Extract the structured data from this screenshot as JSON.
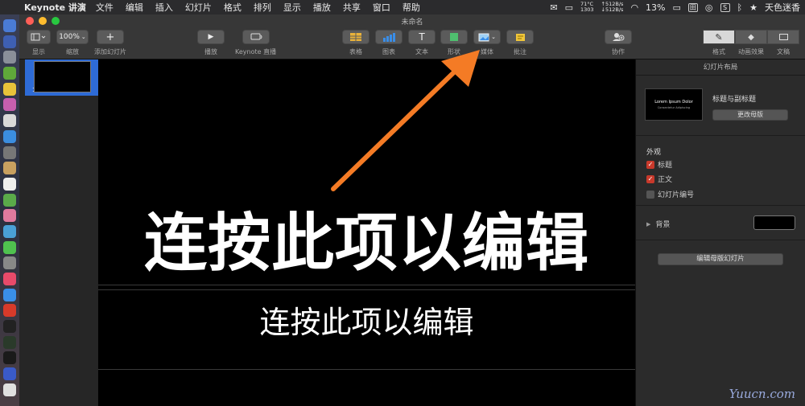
{
  "menubar": {
    "app_name": "Keynote 讲演",
    "items": [
      "文件",
      "编辑",
      "插入",
      "幻灯片",
      "格式",
      "排列",
      "显示",
      "播放",
      "共享",
      "窗口",
      "帮助"
    ],
    "temp": "71°C",
    "fan": "1303",
    "net_up": "↑512B/s",
    "net_down": "↓512B/s",
    "battery": "13%",
    "input_method": "田",
    "user": "天色迷香"
  },
  "window": {
    "title": "未命名"
  },
  "toolbar": {
    "view_label": "显示",
    "zoom_value": "100%",
    "zoom_label": "缩放",
    "add_slide_label": "添加幻灯片",
    "play_label": "播放",
    "keynote_live_label": "Keynote 直播",
    "table_label": "表格",
    "chart_label": "图表",
    "text_label": "文本",
    "shape_label": "形状",
    "media_label": "媒体",
    "comment_label": "批注",
    "collaborate_label": "协作",
    "format_label": "格式",
    "animate_label": "动画效果",
    "document_label": "文稿"
  },
  "navigator": {
    "slide_number": "1"
  },
  "slide": {
    "title": "连按此项以编辑",
    "subtitle": "连按此项以编辑"
  },
  "inspector": {
    "header": "幻灯片布局",
    "master_thumb_title": "Lorem Ipsum Dolor",
    "master_thumb_sub": "Consectetur Adipiscing",
    "master_name": "标题与副标题",
    "change_master_button": "更改母版",
    "appearance_title": "外观",
    "opt_title": "标题",
    "opt_body": "正文",
    "opt_slide_number": "幻灯片编号",
    "background_label": "背景",
    "edit_master_button": "编辑母版幻灯片"
  },
  "checks": {
    "title": true,
    "body": true,
    "slide_number": false
  },
  "colors": {
    "annotation_arrow": "#f47b25",
    "accent_selection": "#2e6bd6",
    "checkbox_on": "#c8392b"
  },
  "watermark": "Yuucn.com"
}
